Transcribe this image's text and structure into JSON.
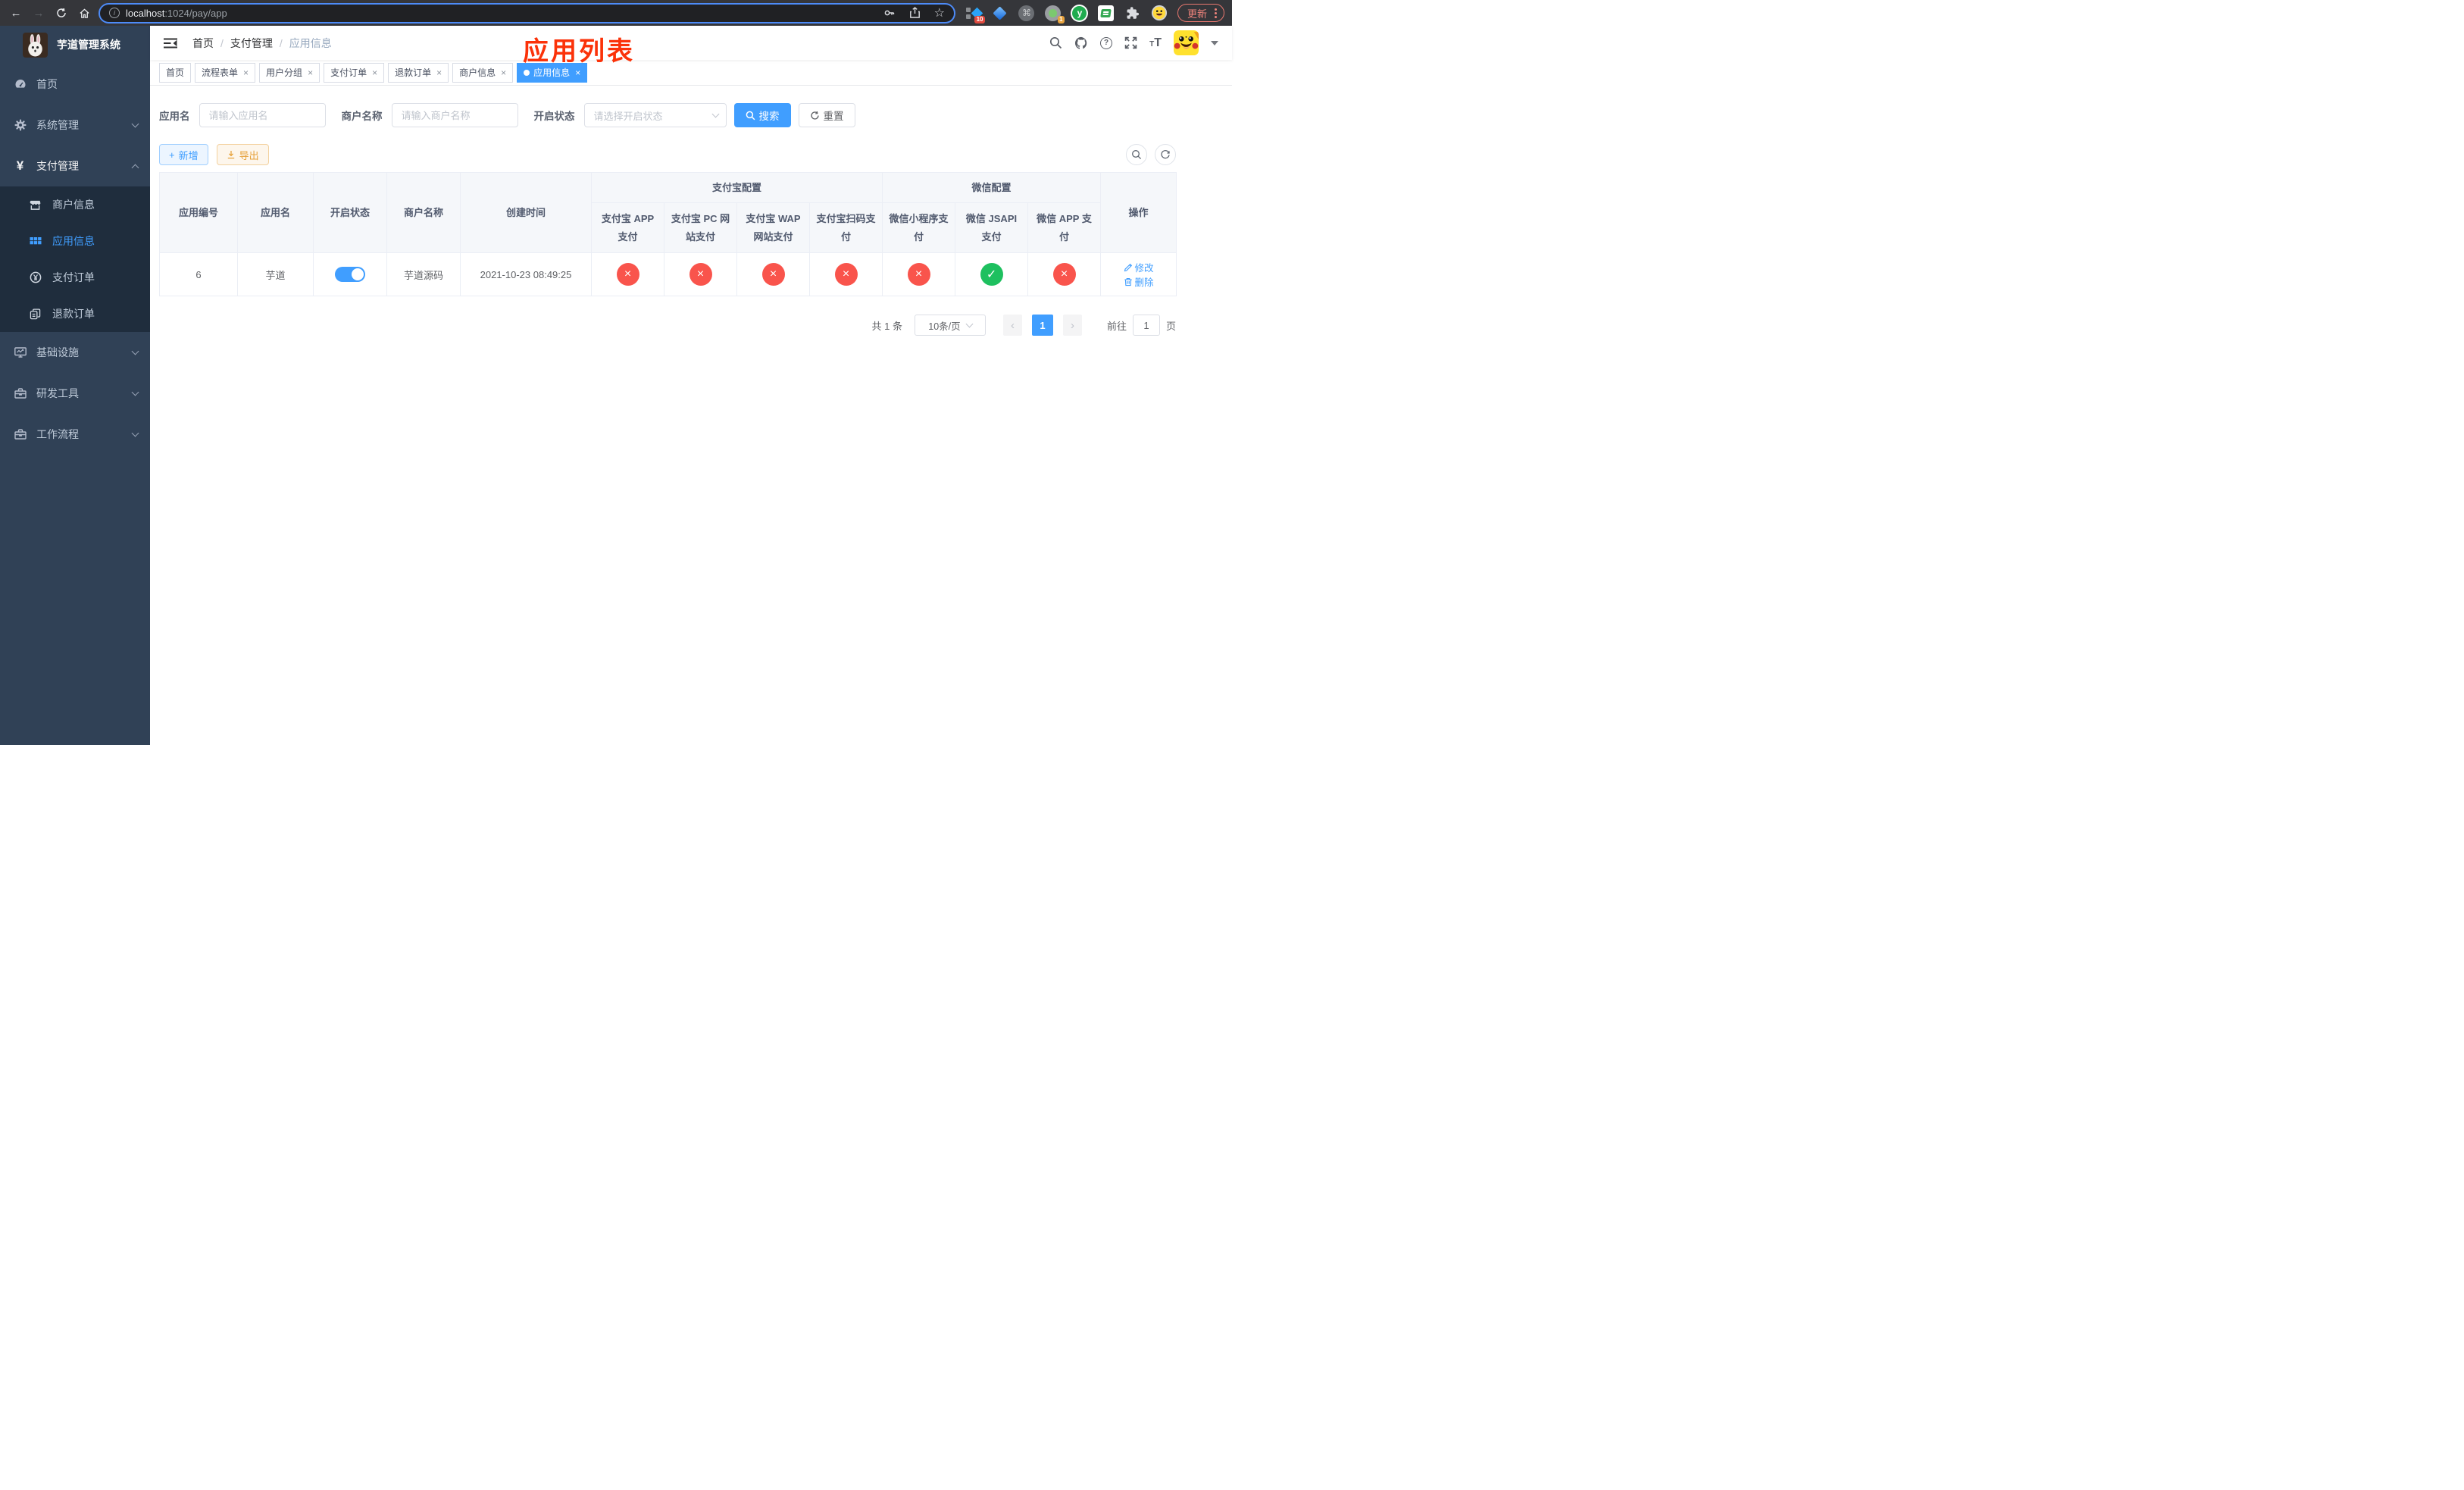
{
  "browser": {
    "url_host": "localhost",
    "url_path": ":1024/pay/app",
    "extensions": {
      "badge_ten": "10",
      "badge_one": "1",
      "y_label": "y",
      "cmd_glyph": "⌘"
    },
    "update_label": "更新"
  },
  "sidebar": {
    "title": "芋道管理系统",
    "menu": [
      {
        "label": "首页"
      },
      {
        "label": "系统管理"
      },
      {
        "label": "支付管理"
      },
      {
        "label": "基础设施"
      },
      {
        "label": "研发工具"
      },
      {
        "label": "工作流程"
      }
    ],
    "pay_submenu": [
      {
        "label": "商户信息"
      },
      {
        "label": "应用信息"
      },
      {
        "label": "支付订单"
      },
      {
        "label": "退款订单"
      }
    ]
  },
  "navbar": {
    "breadcrumb": [
      "首页",
      "支付管理",
      "应用信息"
    ],
    "annotation": "应用列表"
  },
  "tags": [
    {
      "label": "首页"
    },
    {
      "label": "流程表单"
    },
    {
      "label": "用户分组"
    },
    {
      "label": "支付订单"
    },
    {
      "label": "退款订单"
    },
    {
      "label": "商户信息"
    },
    {
      "label": "应用信息"
    }
  ],
  "filters": {
    "app_name_label": "应用名",
    "app_name_placeholder": "请输入应用名",
    "merchant_name_label": "商户名称",
    "merchant_name_placeholder": "请输入商户名称",
    "status_label": "开启状态",
    "status_placeholder": "请选择开启状态",
    "search_label": "搜索",
    "reset_label": "重置"
  },
  "toolbar": {
    "add_label": "新增",
    "export_label": "导出"
  },
  "table": {
    "columns": [
      "应用编号",
      "应用名",
      "开启状态",
      "商户名称",
      "创建时间"
    ],
    "groups": [
      {
        "label": "支付宝配置",
        "children": [
          "支付宝 APP 支付",
          "支付宝 PC 网站支付",
          "支付宝 WAP 网站支付",
          "支付宝扫码支付"
        ]
      },
      {
        "label": "微信配置",
        "children": [
          "微信小程序支付",
          "微信 JSAPI 支付",
          "微信 APP 支付"
        ]
      }
    ],
    "actions_column": "操作",
    "row": {
      "id": "6",
      "name": "芋道",
      "enabled": true,
      "merchant": "芋道源码",
      "created_at": "2021-10-23 08:49:25",
      "channels": [
        false,
        false,
        false,
        false,
        false,
        true,
        false
      ],
      "edit_label": "修改",
      "delete_label": "删除"
    },
    "glyphs": {
      "enabled": "✓",
      "disabled": "×"
    }
  },
  "pagination": {
    "total_text": "共 1 条",
    "page_size_text": "10条/页",
    "current_page": "1",
    "goto_label": "前往",
    "goto_value": "1",
    "page_unit": "页"
  },
  "colors": {
    "primary": "#409eff",
    "success": "#1ec05f",
    "danger": "#f9544c",
    "warning": "#e6a23c",
    "sidebar_bg": "#304156",
    "submenu_bg": "#1f2d3d",
    "annotation_red": "#fb3209"
  }
}
